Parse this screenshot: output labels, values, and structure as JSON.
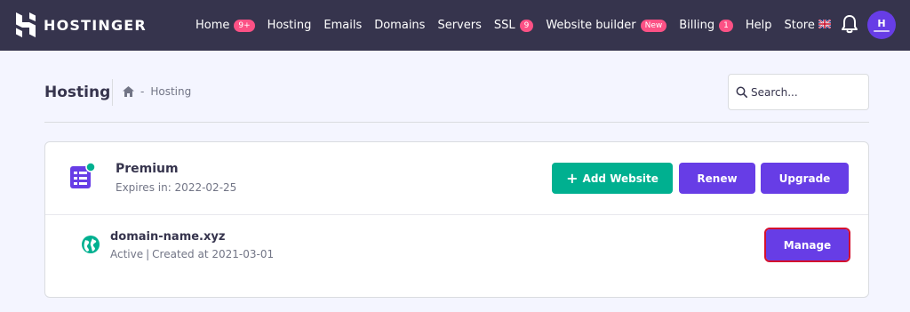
{
  "app": {
    "brand": "HOSTINGER",
    "colors": {
      "nav_bg": "#36344d",
      "primary": "#673de6",
      "success": "#00b090",
      "badge": "#fc5185",
      "highlight": "#d4102e"
    }
  },
  "nav": {
    "items": [
      {
        "label": "Home",
        "badge": "9+"
      },
      {
        "label": "Hosting"
      },
      {
        "label": "Emails"
      },
      {
        "label": "Domains"
      },
      {
        "label": "Servers"
      },
      {
        "label": "SSL",
        "badge": "9"
      },
      {
        "label": "Website builder",
        "badge": "New"
      },
      {
        "label": "Billing",
        "badge": "1"
      },
      {
        "label": "Help"
      },
      {
        "label": "Store"
      }
    ],
    "right_icons": [
      "uk-flag-icon",
      "bell-icon",
      "avatar"
    ]
  },
  "header": {
    "title": "Hosting",
    "breadcrumb": {
      "icon": "home-icon",
      "separator": "-",
      "current": "Hosting"
    },
    "search": {
      "placeholder": "Search..."
    }
  },
  "plan": {
    "name": "Premium",
    "expires": "Expires in: 2022-02-25",
    "buttons": {
      "add_website": "Add Website",
      "renew": "Renew",
      "upgrade": "Upgrade"
    }
  },
  "domain": {
    "name": "domain-name.xyz",
    "status": "Active",
    "separator": "|",
    "created": "Created at 2021-03-01",
    "manage_label": "Manage"
  }
}
